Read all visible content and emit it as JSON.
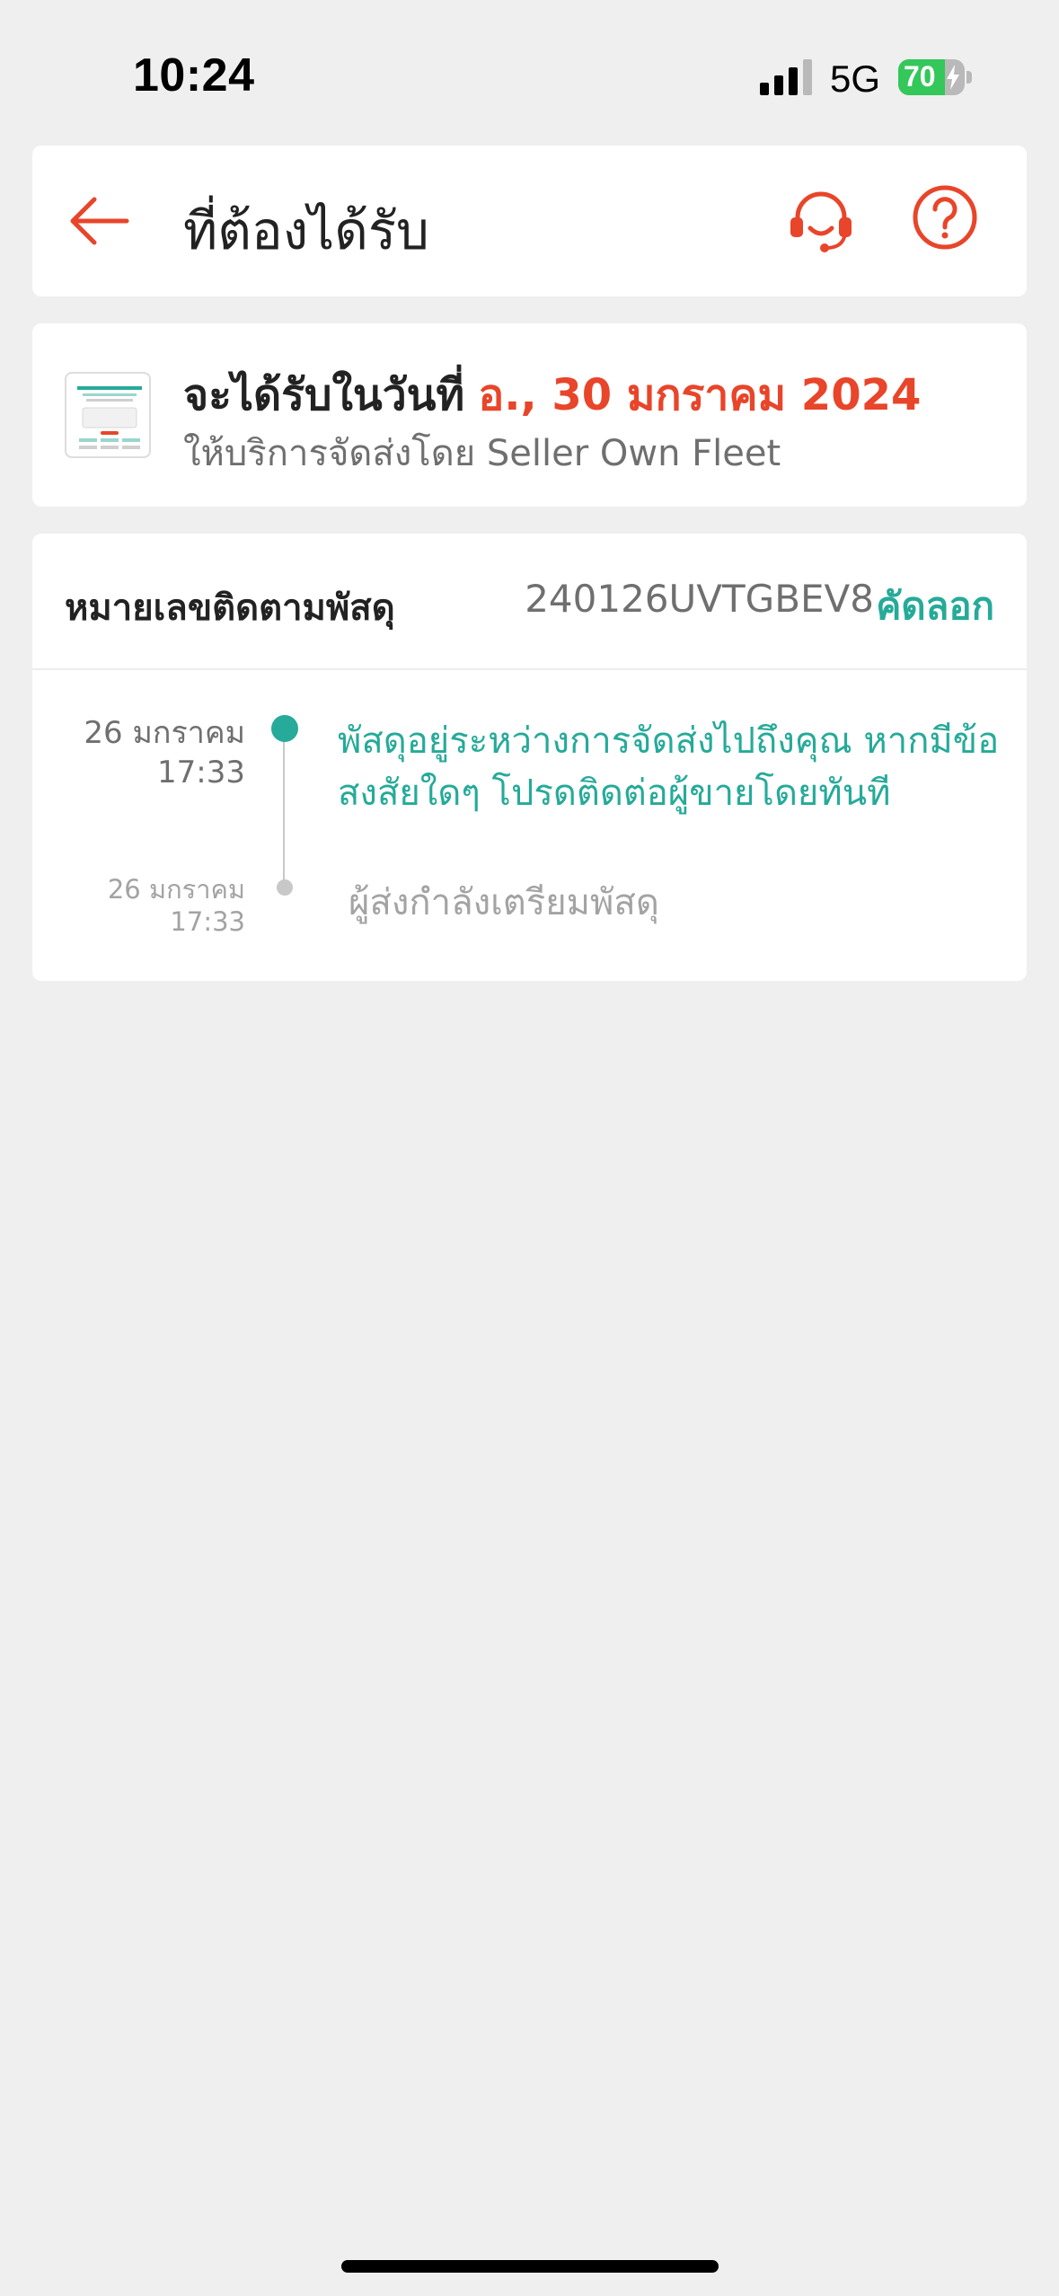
{
  "status_bar": {
    "time": "10:24",
    "network": "5G",
    "battery_percent": "70",
    "battery_level": 0.7,
    "signal_bars": 3,
    "icons": [
      "signal-icon",
      "battery-icon",
      "charging-bolt-icon"
    ]
  },
  "header": {
    "title": "ที่ต้องได้รับ",
    "icons": [
      "back-arrow-icon",
      "headset-icon",
      "help-icon"
    ]
  },
  "delivery": {
    "label": "จะได้รับในวันที่",
    "date": "อ., 30 มกราคม 2024",
    "carrier": "ให้บริการจัดส่งโดย Seller Own Fleet",
    "thumbnail_icon": "product-thumbnail"
  },
  "tracking": {
    "label": "หมายเลขติดตามพัสดุ",
    "number": "240126UVTGBEV8",
    "copy_label": "คัดลอก",
    "events": [
      {
        "date": "26 มกราคม",
        "time": "17:33",
        "text": "พัสดุอยู่ระหว่างการจัดส่งไปถึงคุณ หากมีข้อสงสัยใดๆ โปรดติดต่อผู้ขายโดยทันที",
        "active": true
      },
      {
        "date": "26 มกราคม",
        "time": "17:33",
        "text": "ผู้ส่งกำลังเตรียมพัสดุ",
        "active": false
      }
    ]
  },
  "colors": {
    "accent": "#e8452a",
    "teal": "#26aa99",
    "background": "#efefef",
    "muted_text": "#6f6f6f"
  }
}
